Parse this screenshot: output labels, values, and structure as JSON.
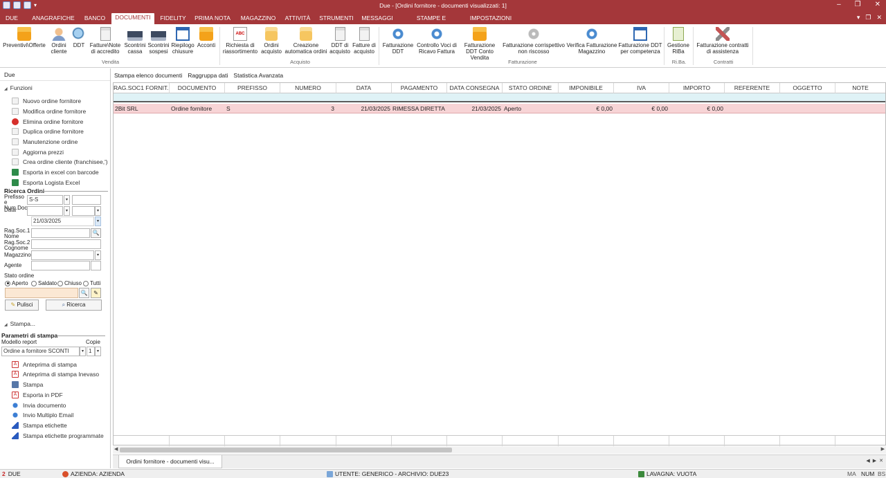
{
  "titlebar": {
    "title": "Due - [Ordini fornitore - documenti visualizzati: 1]"
  },
  "menu": {
    "tabs": [
      {
        "label": "DUE",
        "active": false
      },
      {
        "label": "ANAGRAFICHE",
        "active": false
      },
      {
        "label": "BANCO",
        "active": false
      },
      {
        "label": "DOCUMENTI",
        "active": true
      },
      {
        "label": "FIDELITY",
        "active": false
      },
      {
        "label": "PRIMA NOTA",
        "active": false
      },
      {
        "label": "MAGAZZINO",
        "active": false
      },
      {
        "label": "ATTIVITÀ",
        "active": false
      },
      {
        "label": "STRUMENTI",
        "active": false
      },
      {
        "label": "MESSAGGI",
        "active": false
      },
      {
        "label": "STAMPE E STATISTICHE",
        "active": false
      },
      {
        "label": "IMPOSTAZIONI",
        "active": false
      }
    ]
  },
  "ribbon": {
    "buttons": [
      {
        "label": "Preventivi\\Offerte",
        "icon": "folder-icon"
      },
      {
        "label": "Ordini cliente",
        "icon": "people-icon"
      },
      {
        "label": "DDT",
        "icon": "globe-icon"
      },
      {
        "label": "Fatture\\Note di accredito",
        "icon": "document-icon"
      },
      {
        "label": "Scontrini cassa",
        "icon": "printer-icon"
      },
      {
        "label": "Scontrini sospesi",
        "icon": "printer-icon"
      },
      {
        "label": "Riepilogo chiusure",
        "icon": "window-icon"
      },
      {
        "label": "Acconti",
        "icon": "folder-icon"
      },
      {
        "label": "Richiesta di riassortimento",
        "icon": "abc-document-icon"
      },
      {
        "label": "Ordini acquisto",
        "icon": "box-icon"
      },
      {
        "label": "Creazione automatica ordini",
        "icon": "box-icon"
      },
      {
        "label": "DDT di acquisto",
        "icon": "document-icon"
      },
      {
        "label": "Fatture di acquisto",
        "icon": "document-icon"
      },
      {
        "label": "Fatturazione DDT",
        "icon": "sync-icon"
      },
      {
        "label": "Controllo Voci di Ricavo Fattura",
        "icon": "sync-icon"
      },
      {
        "label": "Fatturazione DDT Conto Vendita",
        "icon": "folder-icon"
      },
      {
        "label": "Fatturazione corrispettivo non riscosso",
        "icon": "disc-icon"
      },
      {
        "label": "Verifica Fatturazione Magazzino",
        "icon": "sync-icon"
      },
      {
        "label": "Fatturazione DDT per competenza",
        "icon": "window-icon"
      },
      {
        "label": "Gestione RiBa",
        "icon": "checklist-icon"
      },
      {
        "label": "Fatturazione contratti di assistenza",
        "icon": "tools-icon"
      }
    ],
    "groups": [
      "Vendita",
      "Acquisto",
      "Fatturazione",
      "Ri.Ba.",
      "Contratti"
    ]
  },
  "left": {
    "header": "Due",
    "funzioni_title": "Funzioni",
    "funzioni": [
      {
        "label": "Nuovo ordine fornitore",
        "icon": "page-icon"
      },
      {
        "label": "Modifica ordine fornitore",
        "icon": "page-icon"
      },
      {
        "label": "Elimina ordine fornitore",
        "icon": "delete-icon"
      },
      {
        "label": "Duplica ordine fornitore",
        "icon": "page-icon"
      },
      {
        "label": "Manutenzione ordine",
        "icon": "page-icon"
      },
      {
        "label": "Aggiorna prezzi",
        "icon": "page-icon"
      },
      {
        "label": "Crea ordine cliente (franchisee,')",
        "icon": "page-icon"
      },
      {
        "label": "Esporta in excel con barcode",
        "icon": "excel-icon"
      },
      {
        "label": "Esporta Logista Excel",
        "icon": "excel-icon"
      }
    ],
    "ricerca": {
      "title": "Ricerca Ordini",
      "prefisso_label": "Prefisso e Num.Doc.",
      "prefisso_value": "S-S",
      "data_label": "Data",
      "data_value": "21/03/2025",
      "ragsoc1_label": "Rag.Soc.1 Nome",
      "ragsoc2_label": "Rag.Soc.2 Cognome",
      "magazzino_label": "Magazzino",
      "agente_label": "Agente",
      "stato_label": "Stato ordine",
      "stati": [
        {
          "label": "Aperto",
          "checked": true
        },
        {
          "label": "Saldato",
          "checked": false
        },
        {
          "label": "Chiuso",
          "checked": false
        },
        {
          "label": "Tutti",
          "checked": false
        }
      ],
      "pulisci_label": "Pulisci",
      "ricerca_label": "Ricerca"
    },
    "stampa_title": "Stampa...",
    "parametri": {
      "title": "Parametri di stampa",
      "modello_label": "Modello report",
      "copie_label": "Copie",
      "modello_value": "Ordine a fornitore SCONTI",
      "copie_value": "1"
    },
    "stampa_items": [
      {
        "label": "Anteprima di stampa",
        "icon": "pdf-icon"
      },
      {
        "label": "Anteprima di stampa Inevaso",
        "icon": "pdf-icon"
      },
      {
        "label": "Stampa",
        "icon": "printer-icon"
      },
      {
        "label": "Esporta in PDF",
        "icon": "pdf-icon"
      },
      {
        "label": "Invia documento",
        "icon": "email-icon"
      },
      {
        "label": "Invio Multiplo Email",
        "icon": "email-icon"
      },
      {
        "label": "Stampa etichette",
        "icon": "label-icon"
      },
      {
        "label": "Stampa etichette programmate",
        "icon": "label-icon"
      }
    ]
  },
  "actionbar": [
    "Stampa elenco documenti",
    "Raggruppa dati",
    "Statistica Avanzata"
  ],
  "grid": {
    "columns": [
      "RAG.SOC1 FORNIT...",
      "DOCUMENTO",
      "PREFISSO",
      "NUMERO",
      "DATA",
      "PAGAMENTO",
      "DATA CONSEGNA",
      "STATO ORDINE",
      "IMPONIBILE",
      "IVA",
      "IMPORTO",
      "REFERENTE",
      "OGGETTO",
      "NOTE"
    ],
    "rows": [
      [
        "2Bit SRL",
        "Ordine fornitore",
        "S",
        "3",
        "21/03/2025",
        "RIMESSA DIRETTA",
        "21/03/2025",
        "Aperto",
        "€ 0,00",
        "€ 0,00",
        "€ 0,00",
        "",
        "",
        ""
      ]
    ]
  },
  "doctab": "Ordini fornitore - documenti visu...",
  "statusbar": {
    "app": "DUE",
    "azienda": "AZIENDA: AZIENDA",
    "utente": "UTENTE: GENERICO - ARCHIVIO: DUE23",
    "lavagna": "LAVAGNA: VUOTA",
    "ma": "MA",
    "num": "NUM",
    "bs": "BS"
  },
  "colors": {
    "accent": "#a4373a",
    "selected_row": "#f7d4d6",
    "filter_row": "#dff2f6"
  }
}
